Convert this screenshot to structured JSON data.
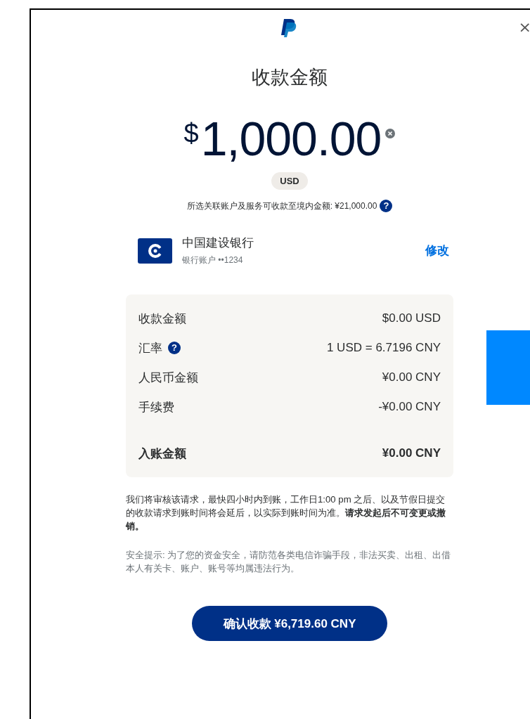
{
  "dialog": {
    "close": "×",
    "title": "收款金额",
    "amount": {
      "currency_symbol": "$",
      "value": "1,000.00"
    },
    "currency": "USD",
    "limit_note": "所选关联账户及服务可收款至境内金额: ¥21,000.00",
    "limit_help": "?"
  },
  "bank": {
    "name": "中国建设银行",
    "account": "银行账户 ••1234",
    "edit": "修改"
  },
  "summary": [
    {
      "label": "收款金额",
      "value": "$0.00 USD",
      "total": false
    },
    {
      "label": "汇率",
      "value": "1 USD = 6.7196 CNY",
      "help": "?",
      "total": false
    },
    {
      "label": "人民币金额",
      "value": "¥0.00 CNY",
      "total": false
    },
    {
      "label": "手续费",
      "value": "-¥0.00 CNY",
      "total": false
    },
    {
      "label": "入账金额",
      "value": "¥0.00 CNY",
      "total": true
    }
  ],
  "notice": "我们将审核该请求，最快四小时内到账，工作日1:00 pm 之后、以及节假日提交的收款请求到账时间将会延后，以实际到账时间为准。**请求发起后不可变更或撤销。**",
  "security_tip": "安全提示: 为了您的资金安全，请防范各类电信诈骗手段，非法买卖、出租、出借本人有关卡、账户、账号等均属违法行为。",
  "confirm_button": "确认收款 ¥6,719.60 CNY"
}
